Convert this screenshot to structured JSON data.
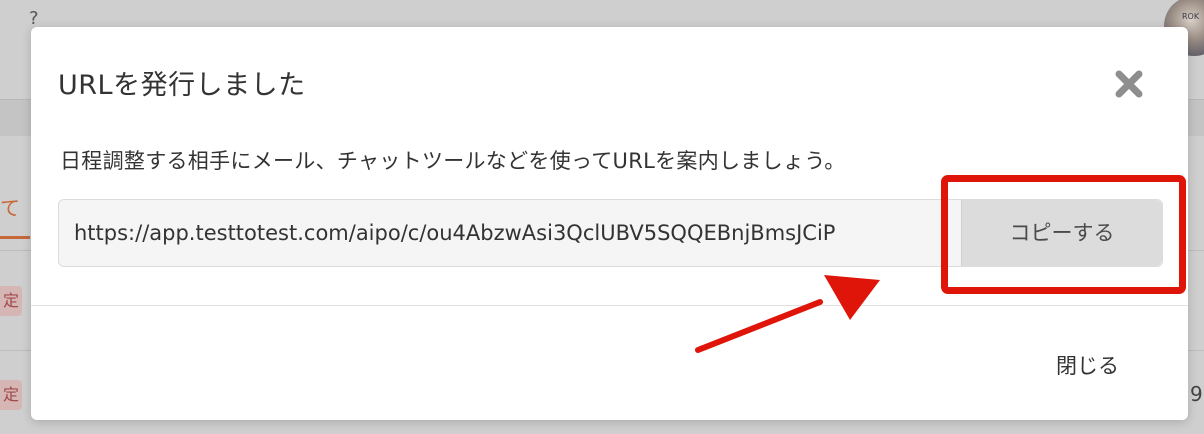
{
  "background": {
    "top_char": "?",
    "tab_text": "て",
    "badge_text": "定",
    "right_char": "9",
    "avatar_text": "ROK"
  },
  "modal": {
    "title": "URLを発行しました",
    "description": "日程調整する相手にメール、チャットツールなどを使ってURLを案内しましょう。",
    "url_value": "https://app.testtotest.com/aipo/c/ou4AbzwAsi3QclUBV5SQQEBnjBmsJCiP",
    "copy_button_label": "コピーする",
    "close_link_label": "閉じる",
    "close_icon": "close-x-icon"
  },
  "annotation": {
    "box_color": "#e0150a",
    "arrow_color": "#e0150a"
  },
  "colors": {
    "accent_orange": "#c7683a",
    "text": "#333333",
    "copy_button_bg": "#dcdcdc",
    "overlay": "#c8c8c8"
  }
}
